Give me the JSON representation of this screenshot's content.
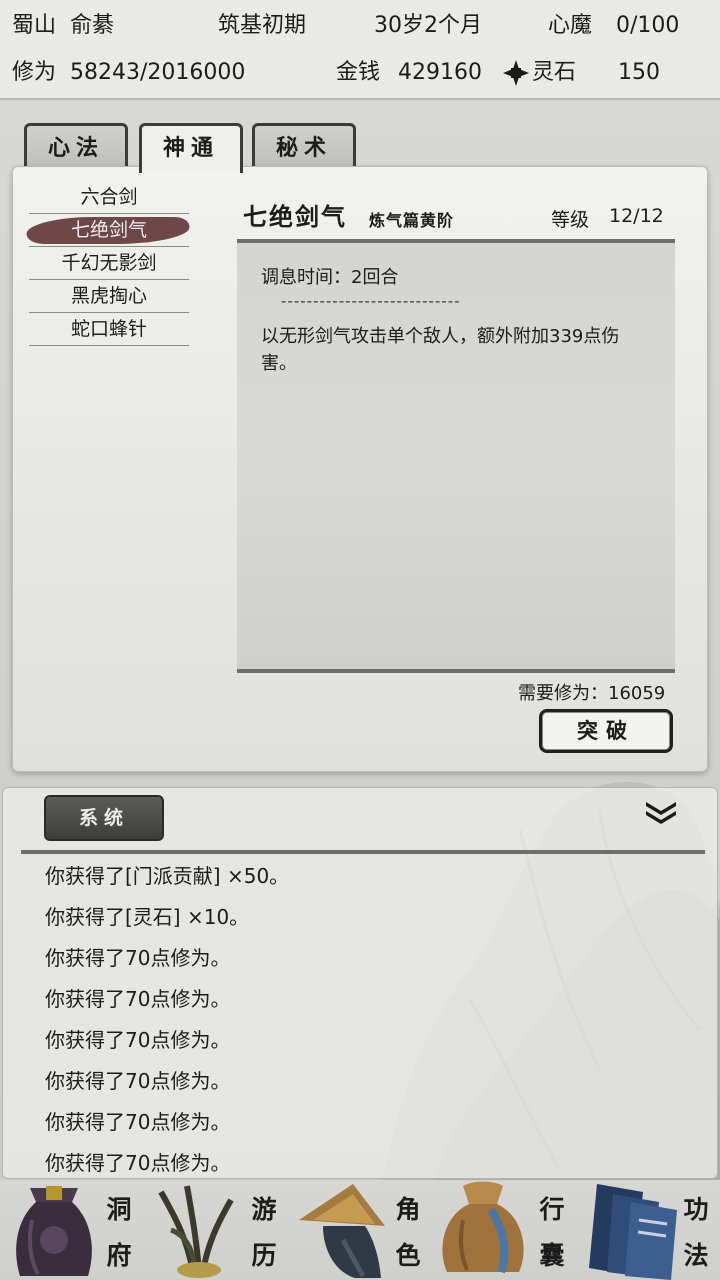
{
  "status": {
    "sect": "蜀山",
    "player_name": "俞綦",
    "realm": "筑基初期",
    "age": "30岁2个月",
    "heart_demon_label": "心魔",
    "heart_demon_value": "0/100",
    "cultivation_label": "修为",
    "cultivation_value": "58243/2016000",
    "money_label": "金钱",
    "money_value": "429160",
    "spirit_stone_label": "灵石",
    "spirit_stone_value": "150",
    "spirit_stone_icon": "spirit-stone-icon"
  },
  "tabs": [
    {
      "label": "心法",
      "active": false
    },
    {
      "label": "神通",
      "active": true
    },
    {
      "label": "秘术",
      "active": false
    }
  ],
  "skills": [
    {
      "name": "六合剑",
      "selected": false
    },
    {
      "name": "七绝剑气",
      "selected": true
    },
    {
      "name": "千幻无影剑",
      "selected": false
    },
    {
      "name": "黑虎掏心",
      "selected": false
    },
    {
      "name": "蛇口蜂针",
      "selected": false
    }
  ],
  "detail": {
    "title": "七绝剑气",
    "grade": "炼气篇黄阶",
    "level_label": "等级",
    "level_value": "12/12",
    "cooldown": "调息时间：2回合",
    "divider": "----------------------------",
    "description": "以无形剑气攻击单个敌人，额外附加339点伤害。",
    "required": "需要修为：16059",
    "breakthrough_label": "突破"
  },
  "log": {
    "tab_label": "系统",
    "collapse_icon": "double-chevron-down-icon",
    "lines": [
      "你获得了[门派贡献] ×50。",
      "你获得了[灵石] ×10。",
      "你获得了70点修为。",
      "你获得了70点修为。",
      "你获得了70点修为。",
      "你获得了70点修为。",
      "你获得了70点修为。",
      "你获得了70点修为。"
    ]
  },
  "nav": [
    {
      "c1": "洞",
      "c2": "府",
      "icon": "treasure-bag-icon"
    },
    {
      "c1": "游",
      "c2": "历",
      "icon": "herb-icon"
    },
    {
      "c1": "角",
      "c2": "色",
      "icon": "straw-hat-icon"
    },
    {
      "c1": "行",
      "c2": "囊",
      "icon": "cloth-bag-icon"
    },
    {
      "c1": "功",
      "c2": "法",
      "icon": "scroll-book-icon"
    }
  ],
  "colors": {
    "selected_skill_brush": "#6e4749",
    "panel_bg": "#efefec",
    "system_tab": "#4a4a48"
  }
}
